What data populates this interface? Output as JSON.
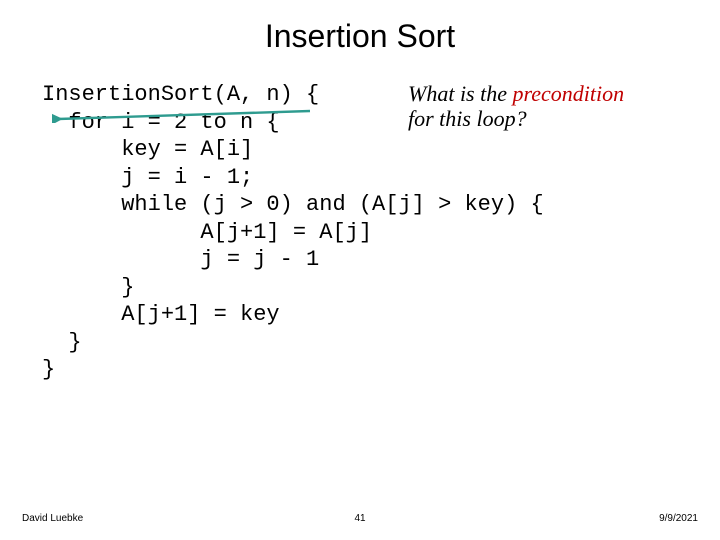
{
  "title": "Insertion Sort",
  "code": {
    "l1": "InsertionSort(A, n) {",
    "l2": "  for i = 2 to n {",
    "l3": "      key = A[i]",
    "l4": "      j = i - 1;",
    "l5": "      while (j > 0) and (A[j] > key) {",
    "l6": "            A[j+1] = A[j]",
    "l7": "            j = j - 1",
    "l8": "      }",
    "l9": "      A[j+1] = key",
    "l10": "  }",
    "l11": "}"
  },
  "annotation": {
    "line1_pre": "What is the ",
    "line1_hl": "precondition",
    "line2": "for this loop?"
  },
  "footer": {
    "author": "David Luebke",
    "page": "41",
    "date": "9/9/2021"
  },
  "arrow_color": "#2e9b8f"
}
